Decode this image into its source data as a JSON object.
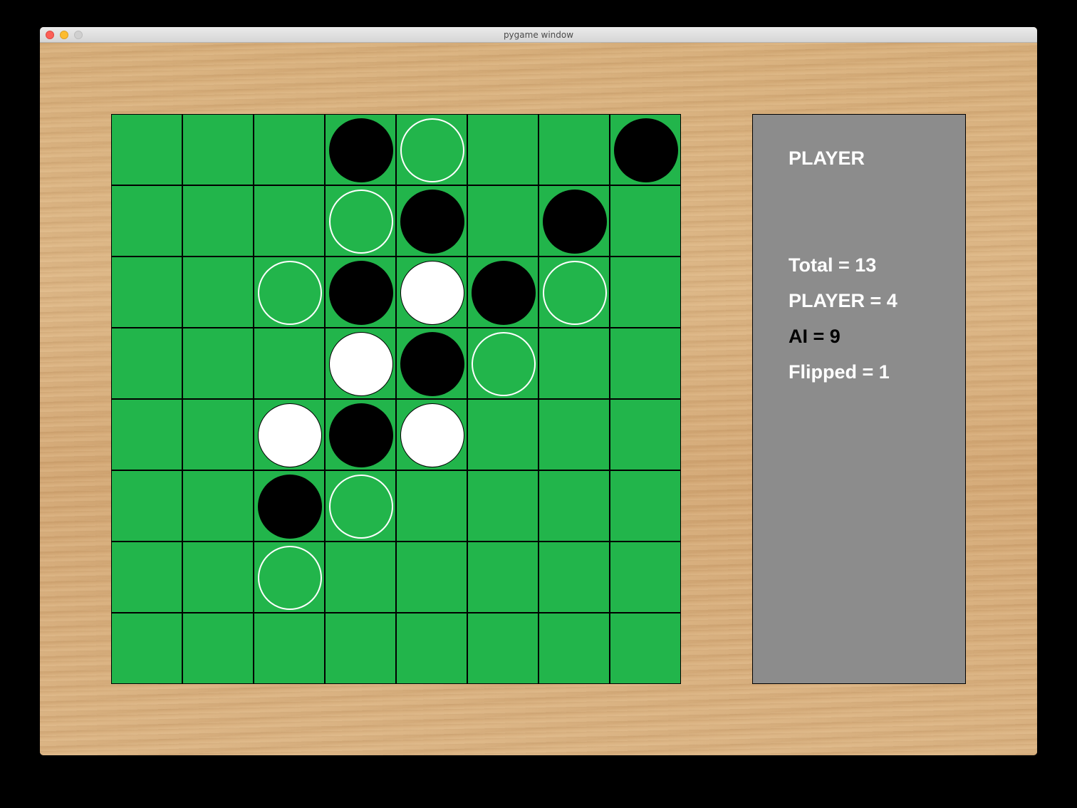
{
  "window": {
    "title": "pygame window"
  },
  "colors": {
    "board_green": "#22b54b",
    "panel_gray": "#8c8c8c",
    "player_disc": "#ffffff",
    "ai_disc": "#000000"
  },
  "board": {
    "size": 8,
    "rows": [
      [
        "",
        "",
        "",
        "B",
        "H",
        "",
        "",
        "B"
      ],
      [
        "",
        "",
        "",
        "H",
        "B",
        "",
        "B",
        ""
      ],
      [
        "",
        "",
        "H",
        "B",
        "W",
        "B",
        "H",
        ""
      ],
      [
        "",
        "",
        "",
        "W",
        "B",
        "H",
        "",
        ""
      ],
      [
        "",
        "",
        "W",
        "B",
        "W",
        "",
        "",
        ""
      ],
      [
        "",
        "",
        "B",
        "H",
        "",
        "",
        "",
        ""
      ],
      [
        "",
        "",
        "H",
        "",
        "",
        "",
        "",
        ""
      ],
      [
        "",
        "",
        "",
        "",
        "",
        "",
        "",
        ""
      ]
    ],
    "legend": {
      "B": "black-disc",
      "W": "white-disc",
      "H": "valid-move-hint"
    }
  },
  "panel": {
    "turn": "PLAYER",
    "total": "Total = 13",
    "player": "PLAYER = 4",
    "ai": "AI = 9",
    "flipped": "Flipped = 1"
  }
}
